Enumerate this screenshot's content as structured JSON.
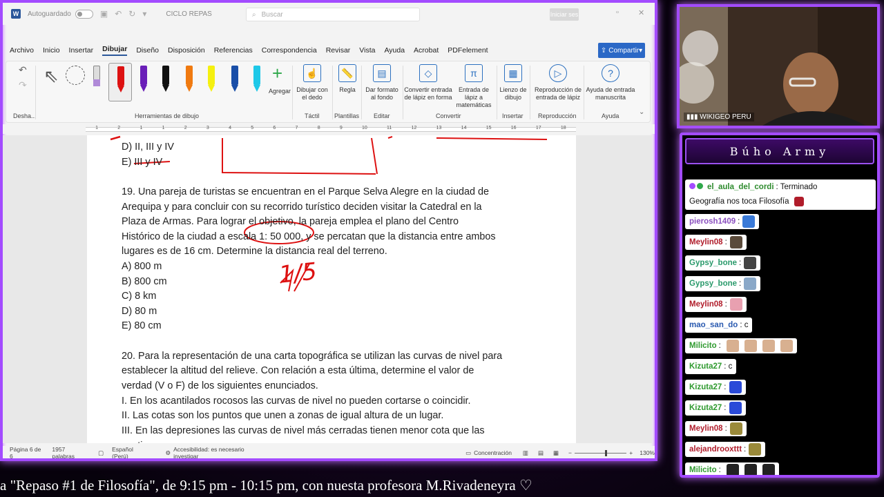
{
  "word": {
    "autosave_label": "Autoguardado",
    "doc_name": "CICLO REPAS",
    "search_placeholder": "Buscar",
    "signin": "Iniciar ses",
    "menu": [
      "Archivo",
      "Inicio",
      "Insertar",
      "Dibujar",
      "Diseño",
      "Disposición",
      "Referencias",
      "Correspondencia",
      "Revisar",
      "Vista",
      "Ayuda",
      "Acrobat",
      "PDFelement"
    ],
    "share_label": "Compartir",
    "ribbon": {
      "undo_label": "Desha...",
      "drawing_tools_label": "Herramientas de dibujo",
      "add_label": "Agregar",
      "touch_draw": "Dibujar con el dedo",
      "touch_group": "Táctil",
      "ruler": "Regla",
      "templates": "Plantillas",
      "format_bg": "Dar formato al fondo",
      "edit": "Editar",
      "ink_to_shape": "Convertir entrada de lápiz en forma",
      "ink_to_math": "Entrada de lápiz a matemáticas",
      "convert": "Convertir",
      "canvas": "Lienzo de dibujo",
      "insert": "Insertar",
      "replay": "Reproducción de entrada de lápiz",
      "replay_group": "Reproducción",
      "help_handwriting": "Ayuda de entrada manuscrita",
      "help": "Ayuda"
    },
    "ruler_nums": [
      "1",
      "2",
      "1",
      "1",
      "2",
      "3",
      "4",
      "5",
      "6",
      "7",
      "8",
      "9",
      "10",
      "11",
      "12",
      "13",
      "14",
      "15",
      "16",
      "17",
      "18"
    ],
    "doc_lines": {
      "d18": "D) II, III y IV",
      "e18": "E) III y IV",
      "q19_1": "19. Una pareja de turistas se encuentran en el Parque Selva Alegre en la ciudad de",
      "q19_2": "Arequipa y para concluir con su recorrido turístico deciden visitar la Catedral en la",
      "q19_3": "Plaza de Armas. Para lograr el objetivo, la pareja emplea el plano del Centro",
      "q19_4": "Histórico de la ciudad a escala 1: 50 000, y se percatan que la distancia entre ambos",
      "q19_5": "lugares es de 16 cm. Determine la distancia real del terreno.",
      "a19": "A) 800 m",
      "b19": "B) 800 cm",
      "c19": "C) 8 km",
      "d19": "D) 80 m",
      "e19": "E) 80 cm",
      "q20_1": "20. Para la representación de una carta topográfica se utilizan las curvas de nivel para",
      "q20_2": "establecer la altitud del relieve. Con relación a esta última, determine el valor de",
      "q20_3": "verdad (V o F) de los siguientes enunciados.",
      "i20": "I. En los acantilados rocosos las curvas de nivel no pueden cortarse o coincidir.",
      "ii20": "II. Las cotas son los puntos que unen a zonas de igual altura de un lugar.",
      "iii20": "III. En las depresiones las curvas de nivel más cerradas tienen menor cota que las",
      "iii20b": "contiguas"
    },
    "ink_note": "1/5",
    "status": {
      "page": "Página 6 de 6",
      "words": "1957 palabras",
      "lang": "Español (Perú)",
      "access": "Accesibilidad: es necesario investigar",
      "focus": "Concentración",
      "zoom": "130%"
    }
  },
  "camera": {
    "label": "WIKIGEO PERU"
  },
  "chat": {
    "title": "Búho Army",
    "messages": [
      {
        "user": "el_aula_del_cordi",
        "text": ": Terminado",
        "text2": "Geografía nos toca Filosofía",
        "color": "#2e8b2e"
      },
      {
        "user": "pierosh1409",
        "text": ":",
        "color": "#8a4fbf"
      },
      {
        "user": "Meylin08",
        "text": ":",
        "color": "#b01c2a"
      },
      {
        "user": "Gypsy_bone",
        "text": ":",
        "color": "#2a9a6b"
      },
      {
        "user": "Gypsy_bone",
        "text": ":",
        "color": "#2a9a6b"
      },
      {
        "user": "Meylin08",
        "text": ":",
        "color": "#b01c2a"
      },
      {
        "user": "mao_san_do",
        "text": ": c",
        "color": "#2a5ab0"
      },
      {
        "user": "Milicito",
        "text": ":",
        "color": "#2f9a2f"
      },
      {
        "user": "Kizuta27",
        "text": ": c",
        "color": "#2f9a2f"
      },
      {
        "user": "Kizuta27",
        "text": ":",
        "color": "#2f9a2f"
      },
      {
        "user": "Kizuta27",
        "text": ":",
        "color": "#2f9a2f"
      },
      {
        "user": "Meylin08",
        "text": ":",
        "color": "#b01c2a"
      },
      {
        "user": "alejandrooxttt",
        "text": ":",
        "color": "#b01c2a"
      },
      {
        "user": "Milicito",
        "text": ":",
        "color": "#2f9a2f"
      }
    ]
  },
  "ticker": "a \"Repaso #1 de Filosofía\", de 9:15 pm - 10:15 pm, con nuesta profesora M.Rivadeneyra ♡"
}
